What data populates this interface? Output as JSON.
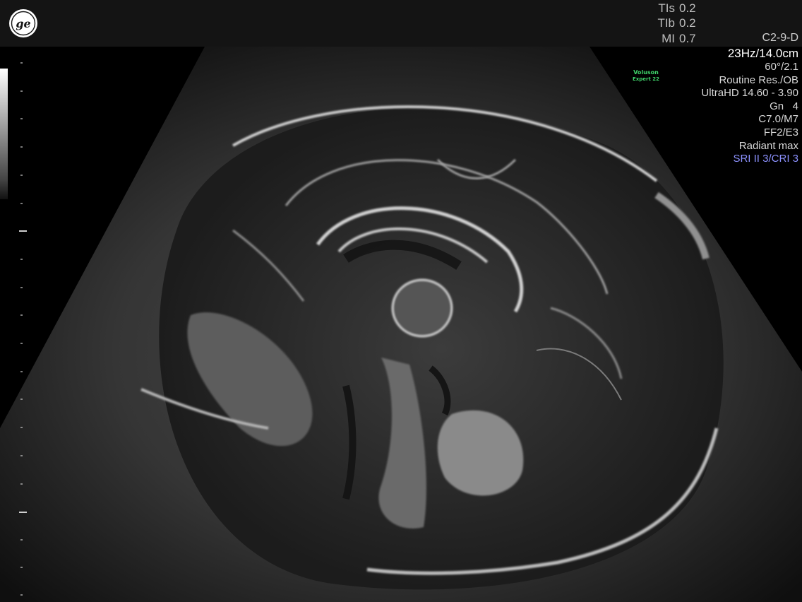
{
  "header": {
    "logo": "GE-logo-icon",
    "safety": [
      {
        "label": "TIs",
        "value": "0.2"
      },
      {
        "label": "TIb",
        "value": "0.2"
      },
      {
        "label": "MI",
        "value": "0.7"
      }
    ]
  },
  "probe": "C2-9-D",
  "brand": {
    "line1": "Voluson",
    "line2": "Expert 22",
    "color": "#3fd36a"
  },
  "params": {
    "frame_depth": "23Hz/14.0cm",
    "angle": "60°/2.1",
    "preset": "Routine Res./OB",
    "ultrahd": "UltraHD 14.60 - 3.90",
    "gain": "Gn   4",
    "cm": "C7.0/M7",
    "ff": "FF2/E3",
    "radiant": "Radiant max",
    "sri": "SRI II 3/CRI 3"
  },
  "colors": {
    "background": "#000000",
    "header": "#141414",
    "text": "#d8d8d8",
    "sri_text": "#8d92ff"
  }
}
